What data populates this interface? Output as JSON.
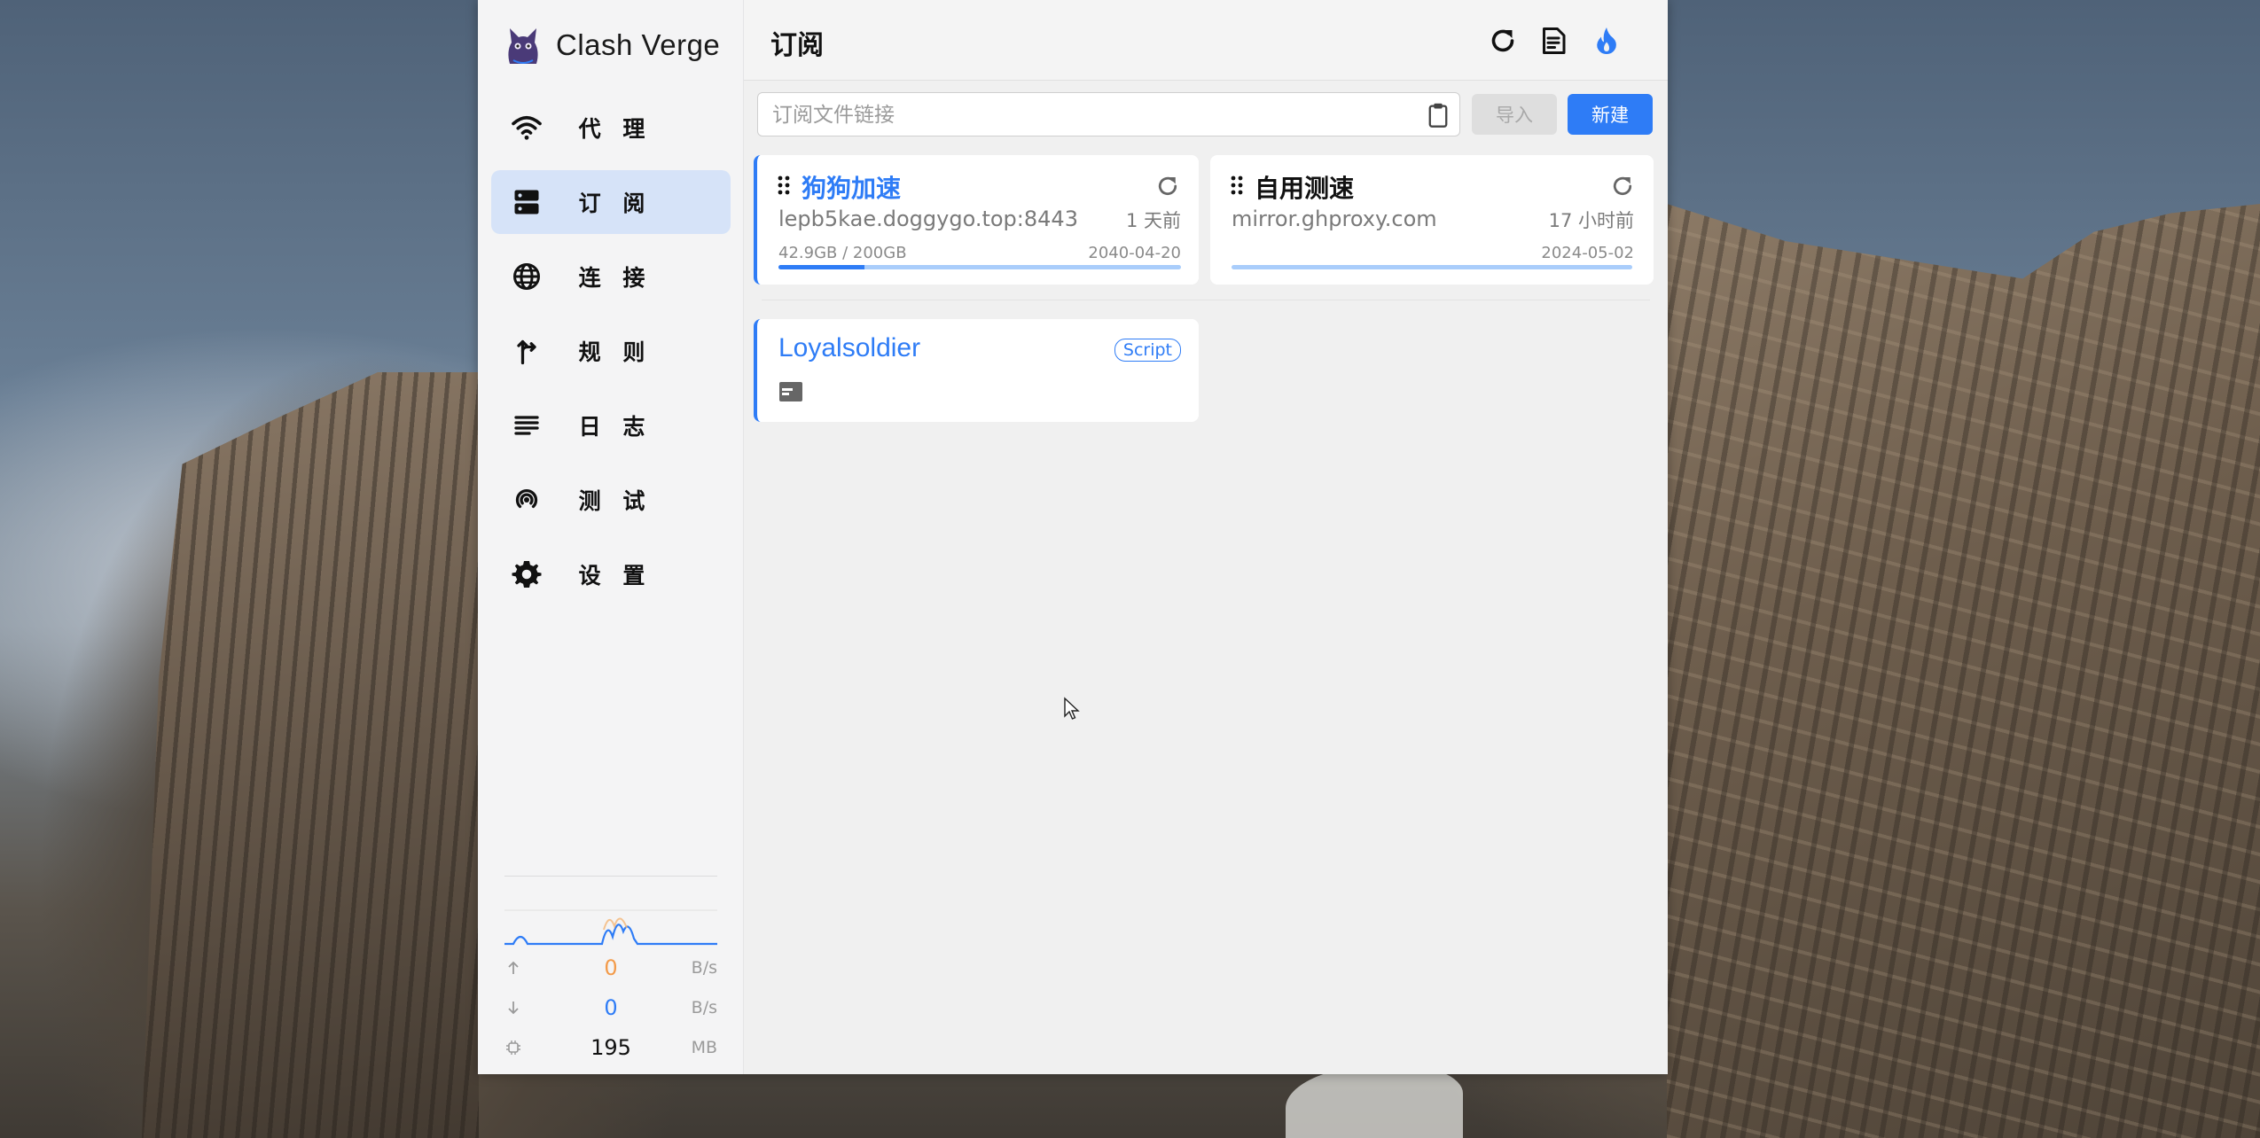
{
  "app": {
    "title": "Clash Verge"
  },
  "sidebar": {
    "items": [
      {
        "label": "代 理",
        "icon": "wifi-icon",
        "active": false
      },
      {
        "label": "订 阅",
        "icon": "dns-icon",
        "active": true
      },
      {
        "label": "连 接",
        "icon": "globe-icon",
        "active": false
      },
      {
        "label": "规 则",
        "icon": "fork-icon",
        "active": false
      },
      {
        "label": "日 志",
        "icon": "list-icon",
        "active": false
      },
      {
        "label": "测 试",
        "icon": "radar-icon",
        "active": false
      },
      {
        "label": "设 置",
        "icon": "gear-icon",
        "active": false
      }
    ],
    "traffic": {
      "upload": {
        "value": "0",
        "unit": "B/s",
        "color": "#f39b4a"
      },
      "download": {
        "value": "0",
        "unit": "B/s",
        "color": "#2e7cf6"
      },
      "memory": {
        "value": "195",
        "unit": "MB"
      }
    }
  },
  "header": {
    "title": "订阅"
  },
  "import_bar": {
    "placeholder": "订阅文件链接",
    "import_label": "导入",
    "new_label": "新建"
  },
  "profiles": [
    {
      "name": "狗狗加速",
      "host": "lepb5kae.doggygo.top:8443",
      "updated": "1 天前",
      "usage": "42.9GB / 200GB",
      "usage_fraction": 0.2145,
      "expire": "2040-04-20",
      "selected": true
    },
    {
      "name": "自用测速",
      "host": "mirror.ghproxy.com",
      "updated": "17 小时前",
      "usage": "",
      "usage_fraction": 0,
      "expire": "2024-05-02",
      "selected": false
    }
  ],
  "scripts": [
    {
      "name": "Loyalsoldier",
      "tag": "Script"
    }
  ],
  "colors": {
    "accent": "#2e7cf6",
    "active_nav": "#d6e3f8"
  }
}
